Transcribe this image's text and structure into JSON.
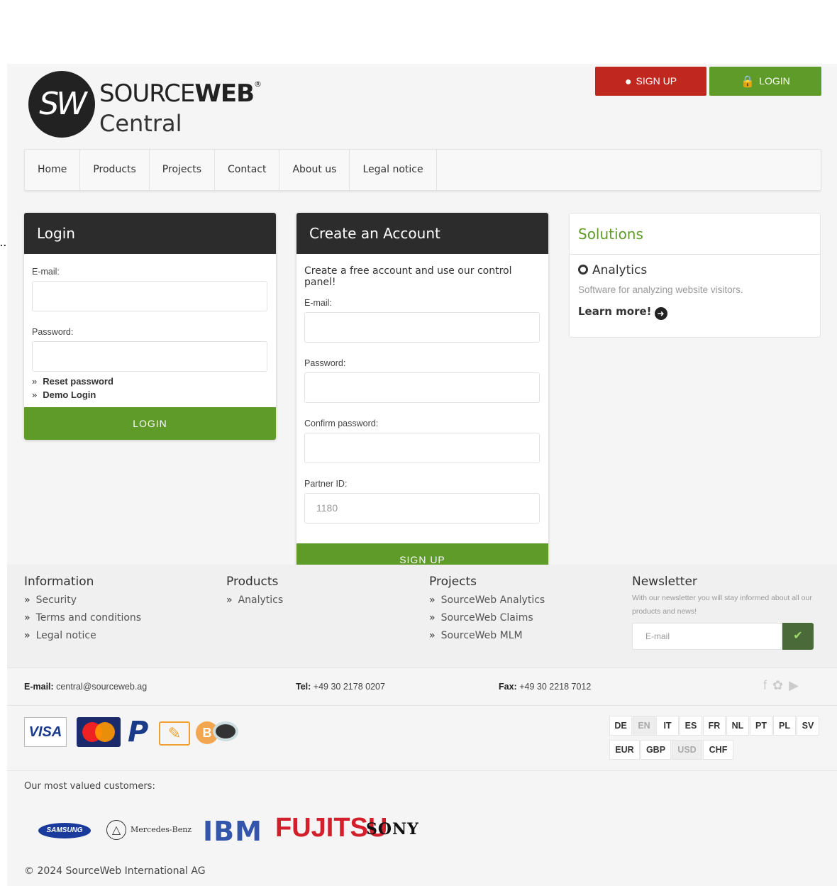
{
  "header": {
    "logo_initials": "SW",
    "logo_title_light": "SOURCE",
    "logo_title_bold": "WEB",
    "logo_reg": "®",
    "logo_subtitle": "Central",
    "signup_label": "SIGN UP",
    "login_label": "LOGIN"
  },
  "side_dots": "..",
  "nav": [
    "Home",
    "Products",
    "Projects",
    "Contact",
    "About us",
    "Legal notice"
  ],
  "login": {
    "title": "Login",
    "email_label": "E-mail:",
    "password_label": "Password:",
    "reset_link": "Reset password",
    "demo_link": "Demo Login",
    "submit": "LOGIN"
  },
  "create": {
    "title": "Create an Account",
    "intro": "Create a free account and use our control panel!",
    "email_label": "E-mail:",
    "password_label": "Password:",
    "confirm_label": "Confirm password:",
    "partner_label": "Partner ID:",
    "partner_value": "1180",
    "submit": "SIGN UP"
  },
  "solutions": {
    "title": "Solutions",
    "item_title": "Analytics",
    "item_desc": "Software for analyzing website visitors.",
    "learn_more": "Learn more!"
  },
  "footer": {
    "information": {
      "title": "Information",
      "links": [
        "Security",
        "Terms and conditions",
        "Legal notice"
      ]
    },
    "products": {
      "title": "Products",
      "links": [
        "Analytics"
      ]
    },
    "projects": {
      "title": "Projects",
      "links": [
        "SourceWeb Analytics",
        "SourceWeb Claims",
        "SourceWeb MLM"
      ]
    },
    "newsletter": {
      "title": "Newsletter",
      "text": "With our newsletter you will stay informed about all our products and news!",
      "placeholder": "E-mail"
    }
  },
  "contact": {
    "email_key": "E-mail:",
    "email_value": "central@sourceweb.ag",
    "tel_key": "Tel:",
    "tel_value": "+49 30 2178 0207",
    "fax_key": "Fax:",
    "fax_value": "+49 30 2218 7012"
  },
  "payments": {
    "visa": "VISA",
    "mastercard": "MasterCard",
    "paypal": "P",
    "bitcoin": "B"
  },
  "languages": [
    "DE",
    "EN",
    "IT",
    "ES",
    "FR",
    "NL",
    "PT",
    "PL",
    "SV"
  ],
  "active_language": "EN",
  "currencies": [
    "EUR",
    "GBP",
    "USD",
    "CHF"
  ],
  "active_currency": "USD",
  "customers": {
    "label": "Our most valued customers:",
    "brands": [
      "SAMSUNG",
      "Mercedes-Benz",
      "IBM",
      "FUJITSU",
      "SONY"
    ]
  },
  "copyright": "© 2024 SourceWeb International AG",
  "colors": {
    "green": "#5e9b28",
    "red": "#c0271f",
    "dark_header": "#2c2c2c"
  }
}
